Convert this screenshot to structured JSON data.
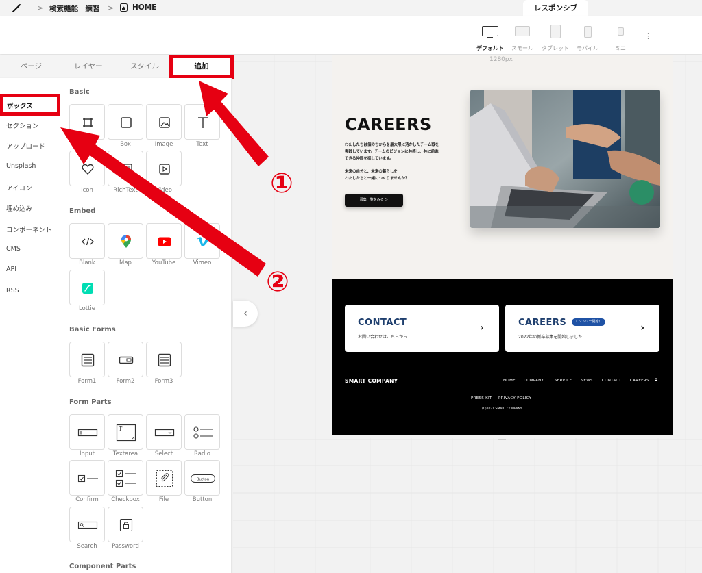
{
  "breadcrumb": {
    "project": "検索機能　練習",
    "page": "HOME",
    "separator": ">"
  },
  "responsive_tab": "レスポンシブ",
  "devices": [
    {
      "label": "デフォルト",
      "active": true
    },
    {
      "label": "スモール",
      "active": false
    },
    {
      "label": "タブレット",
      "active": false
    },
    {
      "label": "モバイル",
      "active": false
    },
    {
      "label": "ミニ",
      "active": false
    }
  ],
  "more_menu": "⋮",
  "panel_tabs": [
    "ページ",
    "レイヤー",
    "スタイル",
    "追加"
  ],
  "categories": [
    "ボックス",
    "セクション",
    "アップロード",
    "Unsplash",
    "アイコン",
    "埋め込み",
    "コンポーネント",
    "CMS",
    "API",
    "RSS"
  ],
  "sections": {
    "basic": {
      "title": "Basic",
      "items": [
        "Section",
        "Box",
        "Image",
        "Text",
        "Icon",
        "RichText",
        "Video"
      ]
    },
    "embed": {
      "title": "Embed",
      "items": [
        "Blank",
        "Map",
        "YouTube",
        "Vimeo",
        "Lottie"
      ]
    },
    "basic_forms": {
      "title": "Basic Forms",
      "items": [
        "Form1",
        "Form2",
        "Form3"
      ]
    },
    "form_parts": {
      "title": "Form Parts",
      "items": [
        "Input",
        "Textarea",
        "Select",
        "Radio",
        "Confirm",
        "Checkbox",
        "File",
        "Button",
        "Search",
        "Password"
      ],
      "button_tile_text": "Button"
    },
    "component_parts": {
      "title": "Component Parts"
    }
  },
  "canvas": {
    "width_label": "1280px",
    "collapse_icon": "‹"
  },
  "site": {
    "hero": {
      "title": "CAREERS",
      "paragraph1": [
        "わたしたちは個のちからを最大限に活かしたチーム戦を",
        "実践しています。チームのビジョンに共感し、共に前進",
        "できる仲間を探しています。"
      ],
      "paragraph2": [
        "未来の自分と、未来の暮らしを",
        "わたしたちと一緒につくりませんか？"
      ],
      "button": "募集一覧をみる ＞"
    },
    "cards": [
      {
        "title": "CONTACT",
        "subtitle": "お問い合わせはこちらから",
        "arrow": "›"
      },
      {
        "title": "CAREERS",
        "badge": "エントリー開始！",
        "subtitle": "2022年の新卒募集を開始しました",
        "arrow": "›"
      }
    ],
    "footer": {
      "brand": "SMART COMPANY",
      "nav": [
        "HOME",
        "COMPANY",
        "SERVICE",
        "NEWS",
        "CONTACT",
        "CAREERS"
      ],
      "external_icon": "⧉",
      "subnav": [
        "PRESS KIT",
        "PRIVACY POLICY"
      ],
      "copyright": "(C)2021 SMART COMPANY."
    }
  },
  "annotations": {
    "one": "①",
    "two": "②",
    "color": "#e60012"
  }
}
